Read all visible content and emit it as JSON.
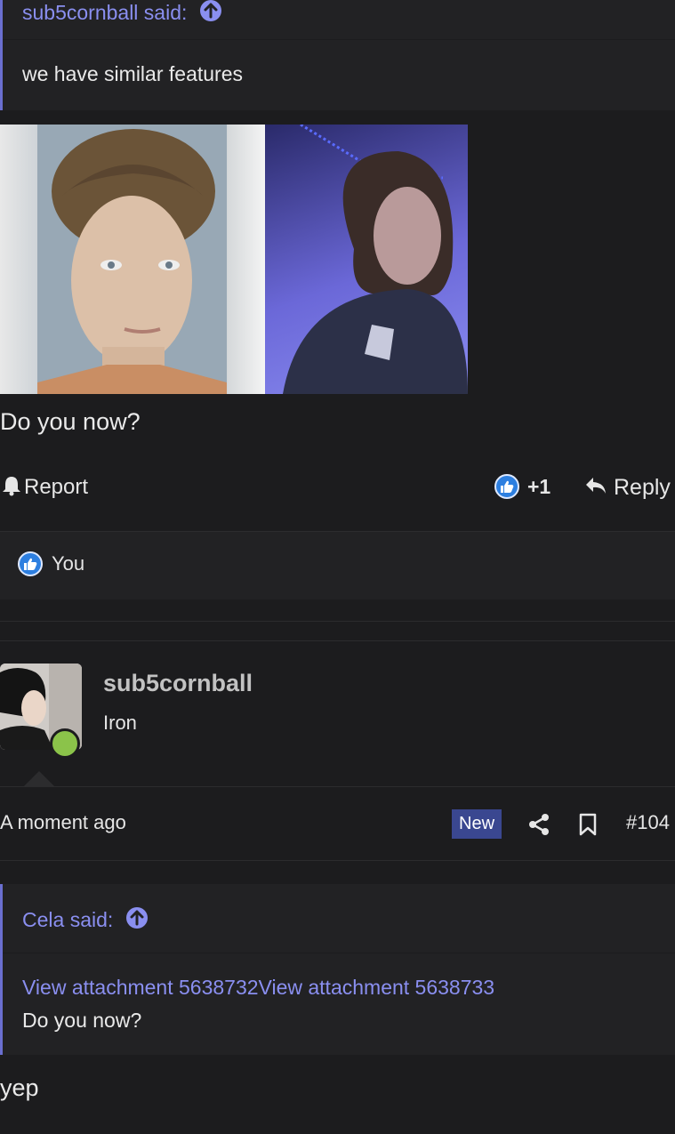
{
  "quote1": {
    "author_label": "sub5cornball said:",
    "text": "we have similar features"
  },
  "post1": {
    "body": "Do you now?",
    "report_label": "Report",
    "like_count": "+1",
    "reply_label": "Reply",
    "liked_by": "You"
  },
  "post2": {
    "username": "sub5cornball",
    "user_title": "Iron",
    "timestamp": "A moment ago",
    "new_badge": "New",
    "post_number": "#104",
    "quote": {
      "author_label": "Cela said:",
      "attachment_1": "View attachment 5638732",
      "attachment_2": "View attachment 5638733",
      "text": "Do you now?"
    },
    "body": "yep"
  },
  "colors": {
    "background": "#1c1c1e",
    "quote_background": "#222224",
    "link": "#8a8ff0",
    "new_badge": "#3a4790",
    "online_dot": "#8bc34a",
    "like_blue": "#2d7fe0"
  },
  "icons": [
    "arrow-up-circle-icon",
    "bell-icon",
    "like-icon",
    "reply-icon",
    "share-icon",
    "bookmark-icon"
  ]
}
